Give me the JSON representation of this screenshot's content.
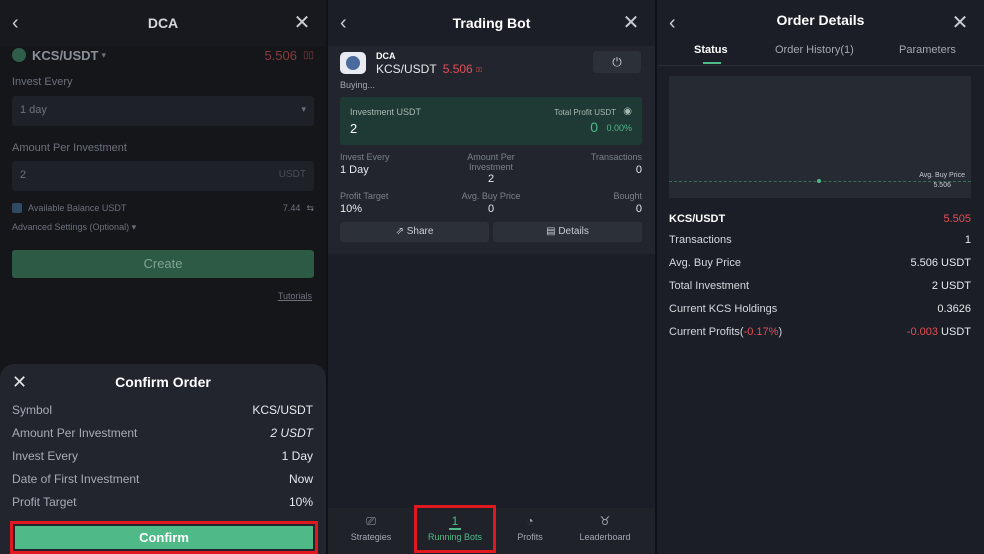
{
  "panel1": {
    "title": "DCA",
    "pair": "KCS/USDT",
    "price": "5.506",
    "invest_every_label": "Invest Every",
    "invest_every_value": "1 day",
    "amount_label": "Amount Per Investment",
    "amount_value": "2",
    "amount_unit": "USDT",
    "available_label": "Available Balance USDT",
    "available_value": "7.44",
    "advanced_label": "Advanced Settings (Optional)",
    "create_label": "Create",
    "tutorials_label": "Tutorials",
    "confirm": {
      "title": "Confirm Order",
      "rows": [
        {
          "label": "Symbol",
          "value": "KCS/USDT"
        },
        {
          "label": "Amount Per Investment",
          "value": "2 USDT"
        },
        {
          "label": "Invest Every",
          "value": "1 Day"
        },
        {
          "label": "Date of First Investment",
          "value": "Now"
        },
        {
          "label": "Profit Target",
          "value": "10%"
        }
      ],
      "button": "Confirm"
    }
  },
  "panel2": {
    "title": "Trading Bot",
    "bot_type": "DCA",
    "pair": "KCS/USDT",
    "price": "5.506",
    "status": "Buying...",
    "investment_label": "Investment USDT",
    "investment_value": "2",
    "total_profit_label": "Total Profit USDT",
    "total_profit_value": "0",
    "total_profit_pct": "0.00%",
    "invest_every_label": "Invest Every",
    "invest_every_value": "1 Day",
    "amount_per_label": "Amount Per Investment",
    "amount_per_value": "2",
    "transactions_label": "Transactions",
    "transactions_value": "0",
    "profit_target_label": "Profit Target",
    "profit_target_value": "10%",
    "avg_buy_label": "Avg. Buy Price",
    "avg_buy_value": "0",
    "bought_label": "Bought",
    "bought_value": "0",
    "share_label": "Share",
    "details_label": "Details",
    "tabs": [
      {
        "label": "Strategies",
        "icon": "strategies-icon"
      },
      {
        "label": "Running Bots",
        "icon": "running-bots-icon",
        "badge": "1"
      },
      {
        "label": "Profits",
        "icon": "profits-icon"
      },
      {
        "label": "Leaderboard",
        "icon": "leaderboard-icon"
      }
    ]
  },
  "panel3": {
    "title": "Order Details",
    "subtabs": [
      "Status",
      "Order History(1)",
      "Parameters"
    ],
    "chart_label": "Avg. Buy Price",
    "chart_value": "5.506",
    "pair": "KCS/USDT",
    "pair_price": "5.505",
    "rows": [
      {
        "label": "Transactions",
        "value": "1"
      },
      {
        "label": "Avg. Buy Price",
        "value": "5.506 USDT"
      },
      {
        "label": "Total Investment",
        "value": "2 USDT"
      },
      {
        "label": "Current KCS Holdings",
        "value": "0.3626"
      }
    ],
    "current_profits_label": "Current Profits",
    "current_profits_pct": "-0.17%",
    "current_profits_value": "-0.003 USDT"
  },
  "colors": {
    "accent_green": "#4fb987",
    "price_red": "#e34d56",
    "highlight_red": "#e0181f"
  }
}
